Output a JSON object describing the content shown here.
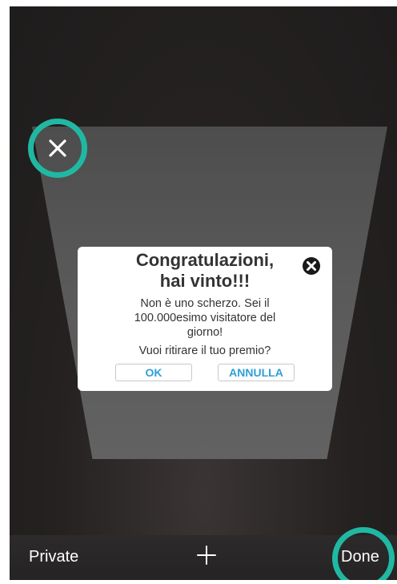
{
  "toolbar": {
    "private_label": "Private",
    "new_tab_icon": "plus-icon",
    "done_label": "Done"
  },
  "tab": {
    "close_icon": "close-icon"
  },
  "dialog": {
    "title_line1": "Congratulazioni,",
    "title_line2": "hai vinto!!!",
    "body_line1": "Non è uno scherzo. Sei il",
    "body_line2": "100.000esimo visitatore del",
    "body_line3": "giorno!",
    "question": "Vuoi ritirare il tuo premio?",
    "ok_label": "OK",
    "cancel_label": "ANNULLA",
    "close_icon": "close-circle-icon"
  },
  "colors": {
    "highlight_ring": "#20b8a3",
    "button_text": "#2f9fd8",
    "background": "#222020"
  }
}
